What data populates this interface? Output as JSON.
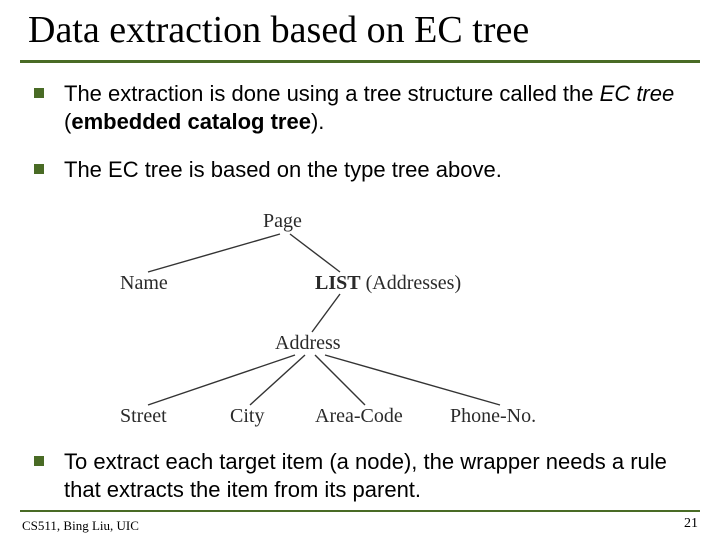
{
  "title": "Data extraction based on EC tree",
  "bullets": {
    "b1_pre": "The extraction is done using a tree structure called the ",
    "b1_em": "EC tree",
    "b1_mid": " (",
    "b1_bold": "embedded catalog tree",
    "b1_post": ").",
    "b2": "The EC tree is based on the type tree above.",
    "b3": "To extract each target item (a node), the wrapper needs a rule that extracts the item from its parent."
  },
  "tree": {
    "page": "Page",
    "name": "Name",
    "list": "LIST",
    "list_note": " (Addresses)",
    "address": "Address",
    "street": "Street",
    "city": "City",
    "areacode": "Area-Code",
    "phoneno": "Phone-No."
  },
  "footer": {
    "left": "CS511, Bing Liu, UIC",
    "page": "21"
  }
}
